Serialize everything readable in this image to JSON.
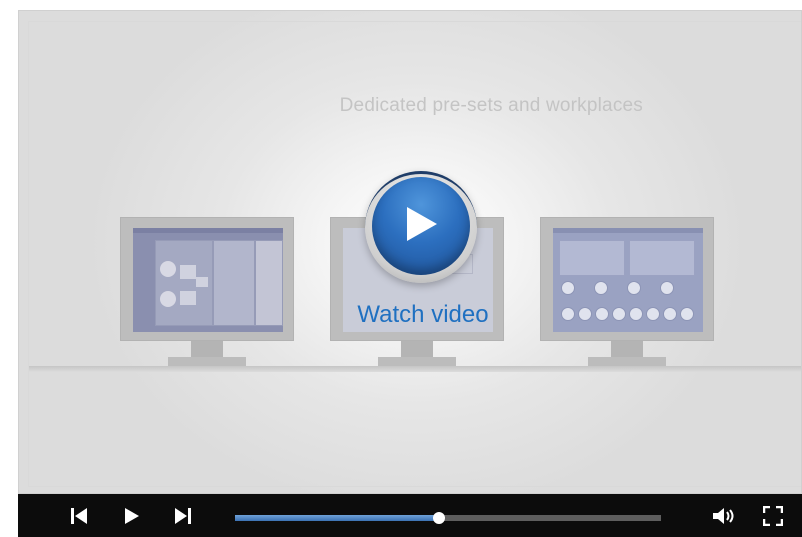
{
  "stage": {
    "title": "Dedicated pre-sets and workplaces",
    "watch_label": "Watch video"
  },
  "controls": {
    "progress": 0.48,
    "icons": {
      "previous": "skip-previous-icon",
      "play": "play-icon",
      "next": "skip-next-icon",
      "volume": "volume-icon",
      "fullscreen": "fullscreen-icon"
    }
  },
  "colors": {
    "accent_blue": "#1f70c1",
    "control_bar": "#0c0c0c",
    "progress_fill": "#3c72b4"
  }
}
